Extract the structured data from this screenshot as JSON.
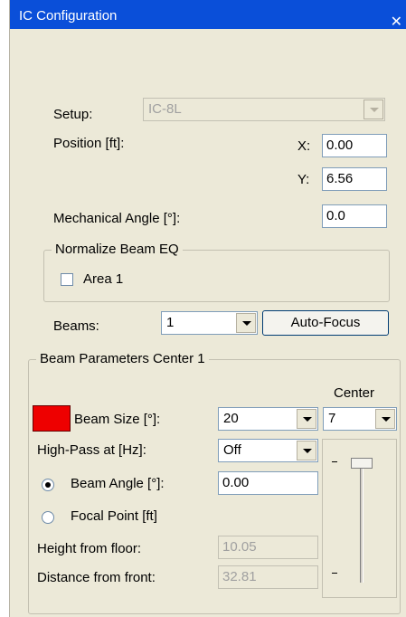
{
  "window": {
    "title": "IC Configuration",
    "close_glyph": "✕"
  },
  "setup": {
    "label": "Setup:",
    "value": "IC-8L"
  },
  "position": {
    "label": "Position [ft]:",
    "x_label": "X:",
    "x_value": "0.00",
    "y_label": "Y:",
    "y_value": "6.56"
  },
  "mechanical_angle": {
    "label": "Mechanical Angle [°]:",
    "value": "0.0"
  },
  "normalize": {
    "group_label": "Normalize Beam EQ",
    "checkbox_label": "Area 1",
    "checked": false
  },
  "beams": {
    "label": "Beams:",
    "value": "1",
    "auto_focus_label": "Auto-Focus"
  },
  "beam_params": {
    "group_label": "Beam Parameters Center 1",
    "center_label": "Center",
    "center_value": "7",
    "swatch_color": "#ee0000",
    "beam_size_label": "Beam Size [°]:",
    "beam_size_value": "20",
    "highpass_label": "High-Pass at [Hz]:",
    "highpass_value": "Off",
    "beam_angle_label": "Beam Angle [°]:",
    "beam_angle_value": "0.00",
    "beam_angle_selected": true,
    "focal_point_label": "Focal Point [ft]",
    "focal_point_selected": false,
    "height_label": "Height from floor:",
    "height_value": "10.05",
    "distance_label": "Distance from front:",
    "distance_value": "32.81",
    "slider_level": 1.0
  },
  "colors": {
    "titlebar": "#0a4fd9",
    "dialog_bg": "#ece9d8"
  }
}
